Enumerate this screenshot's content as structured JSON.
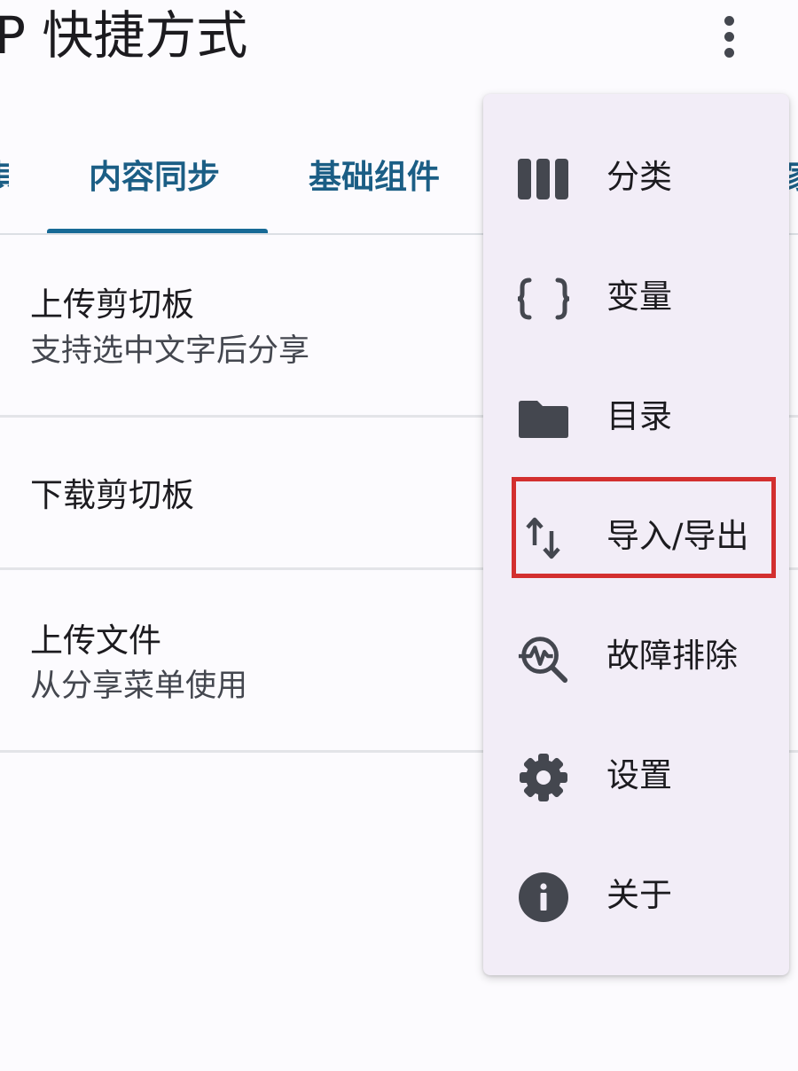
{
  "app": {
    "title": "P 快捷方式"
  },
  "tabs": [
    {
      "label": "其"
    },
    {
      "label": "内容同步"
    },
    {
      "label": "基础组件"
    },
    {
      "label": "家"
    }
  ],
  "list": [
    {
      "title": "上传剪切板",
      "subtitle": "支持选中文字后分享"
    },
    {
      "title": "下载剪切板",
      "subtitle": ""
    },
    {
      "title": "上传文件",
      "subtitle": "从分享菜单使用"
    }
  ],
  "menu": {
    "items": [
      {
        "label": "分类",
        "icon": "columns-icon"
      },
      {
        "label": "变量",
        "icon": "curly-braces-icon"
      },
      {
        "label": "目录",
        "icon": "folder-icon"
      },
      {
        "label": "导入/导出",
        "icon": "swap-vertical-icon"
      },
      {
        "label": "故障排除",
        "icon": "troubleshoot-icon"
      },
      {
        "label": "设置",
        "icon": "gear-icon"
      },
      {
        "label": "关于",
        "icon": "info-icon"
      }
    ]
  },
  "colors": {
    "accent": "#176a96",
    "tab_text": "#1b5e85",
    "menu_bg": "#f2edf7",
    "icon": "#44474f",
    "highlight": "#d32f2f",
    "background": "#fcfbfe"
  }
}
